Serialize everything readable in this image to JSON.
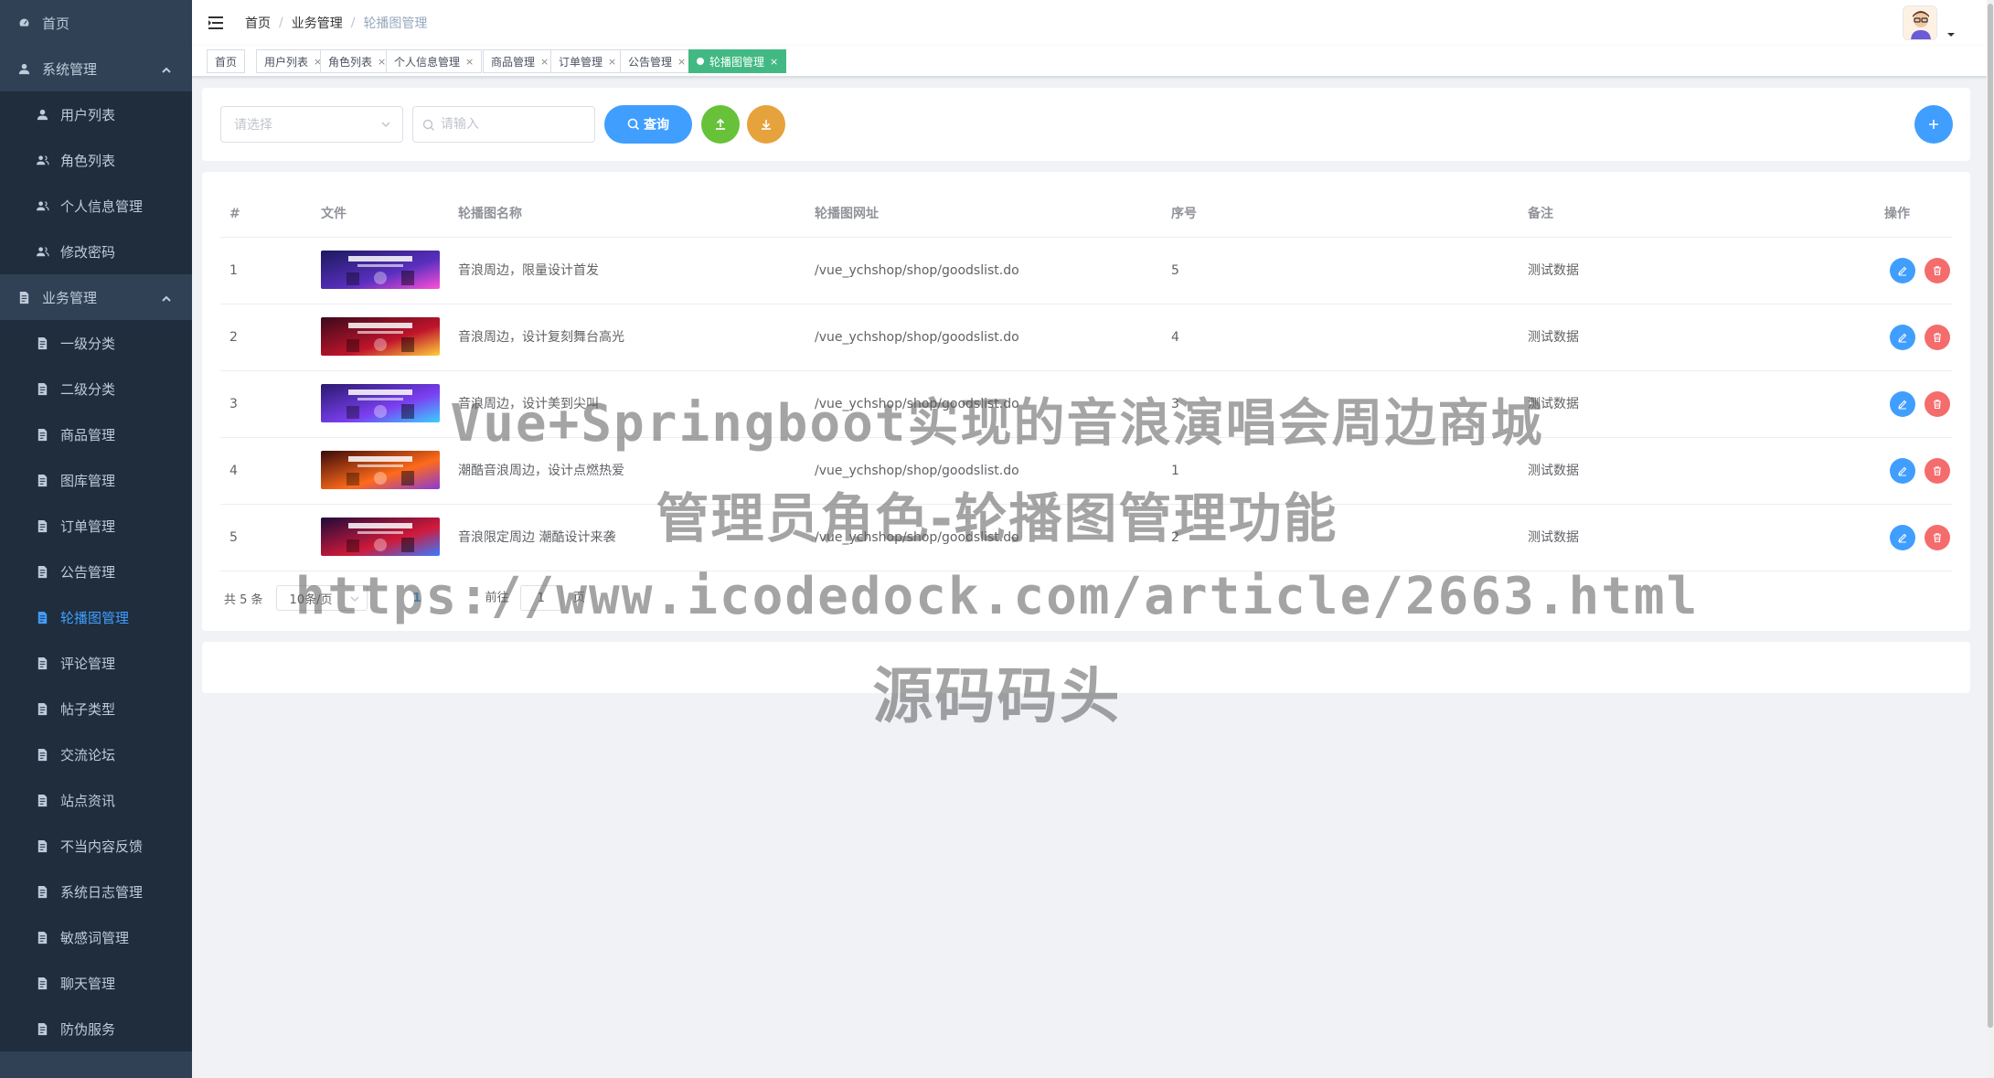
{
  "sidebar": {
    "items": [
      {
        "label": "首页",
        "level": 1,
        "icon": "dashboard-icon"
      },
      {
        "label": "系统管理",
        "level": 1,
        "icon": "user-icon",
        "expanded": true
      },
      {
        "label": "用户列表",
        "level": 2,
        "icon": "user-icon"
      },
      {
        "label": "角色列表",
        "level": 2,
        "icon": "peoples-icon"
      },
      {
        "label": "个人信息管理",
        "level": 2,
        "icon": "peoples-icon"
      },
      {
        "label": "修改密码",
        "level": 2,
        "icon": "peoples-icon"
      },
      {
        "label": "业务管理",
        "level": 1,
        "icon": "document-icon",
        "expanded": true
      },
      {
        "label": "一级分类",
        "level": 2,
        "icon": "document-icon"
      },
      {
        "label": "二级分类",
        "level": 2,
        "icon": "document-icon"
      },
      {
        "label": "商品管理",
        "level": 2,
        "icon": "document-icon"
      },
      {
        "label": "图库管理",
        "level": 2,
        "icon": "document-icon"
      },
      {
        "label": "订单管理",
        "level": 2,
        "icon": "document-icon"
      },
      {
        "label": "公告管理",
        "level": 2,
        "icon": "document-icon"
      },
      {
        "label": "轮播图管理",
        "level": 2,
        "icon": "document-icon",
        "active": true
      },
      {
        "label": "评论管理",
        "level": 2,
        "icon": "document-icon"
      },
      {
        "label": "帖子类型",
        "level": 2,
        "icon": "document-icon"
      },
      {
        "label": "交流论坛",
        "level": 2,
        "icon": "document-icon"
      },
      {
        "label": "站点资讯",
        "level": 2,
        "icon": "document-icon"
      },
      {
        "label": "不当内容反馈",
        "level": 2,
        "icon": "document-icon"
      },
      {
        "label": "系统日志管理",
        "level": 2,
        "icon": "document-icon"
      },
      {
        "label": "敏感词管理",
        "level": 2,
        "icon": "document-icon"
      },
      {
        "label": "聊天管理",
        "level": 2,
        "icon": "document-icon"
      },
      {
        "label": "防伪服务",
        "level": 2,
        "icon": "document-icon"
      }
    ]
  },
  "breadcrumb": [
    "首页",
    "业务管理",
    "轮播图管理"
  ],
  "tags": [
    {
      "label": "首页",
      "closable": false,
      "active": false
    },
    {
      "label": "用户列表",
      "closable": true,
      "active": false
    },
    {
      "label": "角色列表",
      "closable": true,
      "active": false
    },
    {
      "label": "个人信息管理",
      "closable": true,
      "active": false
    },
    {
      "label": "商品管理",
      "closable": true,
      "active": false
    },
    {
      "label": "订单管理",
      "closable": true,
      "active": false
    },
    {
      "label": "公告管理",
      "closable": true,
      "active": false
    },
    {
      "label": "轮播图管理",
      "closable": true,
      "active": true
    }
  ],
  "search": {
    "select_placeholder": "请选择",
    "input_placeholder": "请输入",
    "query_label": "查询"
  },
  "table": {
    "headers": [
      "#",
      "文件",
      "轮播图名称",
      "轮播图网址",
      "序号",
      "备注",
      "操作"
    ],
    "rows": [
      {
        "index": "1",
        "name": "音浪周边，限量设计首发",
        "url": "/vue_ychshop/shop/goodslist.do",
        "order": "5",
        "remark": "测试数据"
      },
      {
        "index": "2",
        "name": "音浪周边，设计复刻舞台高光",
        "url": "/vue_ychshop/shop/goodslist.do",
        "order": "4",
        "remark": "测试数据"
      },
      {
        "index": "3",
        "name": "音浪周边，设计美到尖叫",
        "url": "/vue_ychshop/shop/goodslist.do",
        "order": "3",
        "remark": "测试数据"
      },
      {
        "index": "4",
        "name": "潮酷音浪周边，设计点燃热爱",
        "url": "/vue_ychshop/shop/goodslist.do",
        "order": "1",
        "remark": "测试数据"
      },
      {
        "index": "5",
        "name": "音浪限定周边 潮酷设计来袭",
        "url": "/vue_ychshop/shop/goodslist.do",
        "order": "2",
        "remark": "测试数据"
      }
    ]
  },
  "pagination": {
    "total": "共 5 条",
    "page_size": "10条/页",
    "current": "1",
    "goto_label": "前往",
    "goto_value": "1",
    "page_suffix": "页"
  },
  "watermark": {
    "line1": "Vue+Springboot实现的音浪演唱会周边商城",
    "line2": "管理员角色-轮播图管理功能",
    "line3": "https://www.icodedock.com/article/2663.html",
    "line4": "源码码头"
  },
  "colors": {
    "sidebar_bg": "#304156",
    "sidebar_sub_bg": "#1f2d3d",
    "primary": "#409eff",
    "success": "#67c23a",
    "warning": "#e6a23c",
    "danger": "#f56c6c",
    "tag_active": "#42b983"
  }
}
